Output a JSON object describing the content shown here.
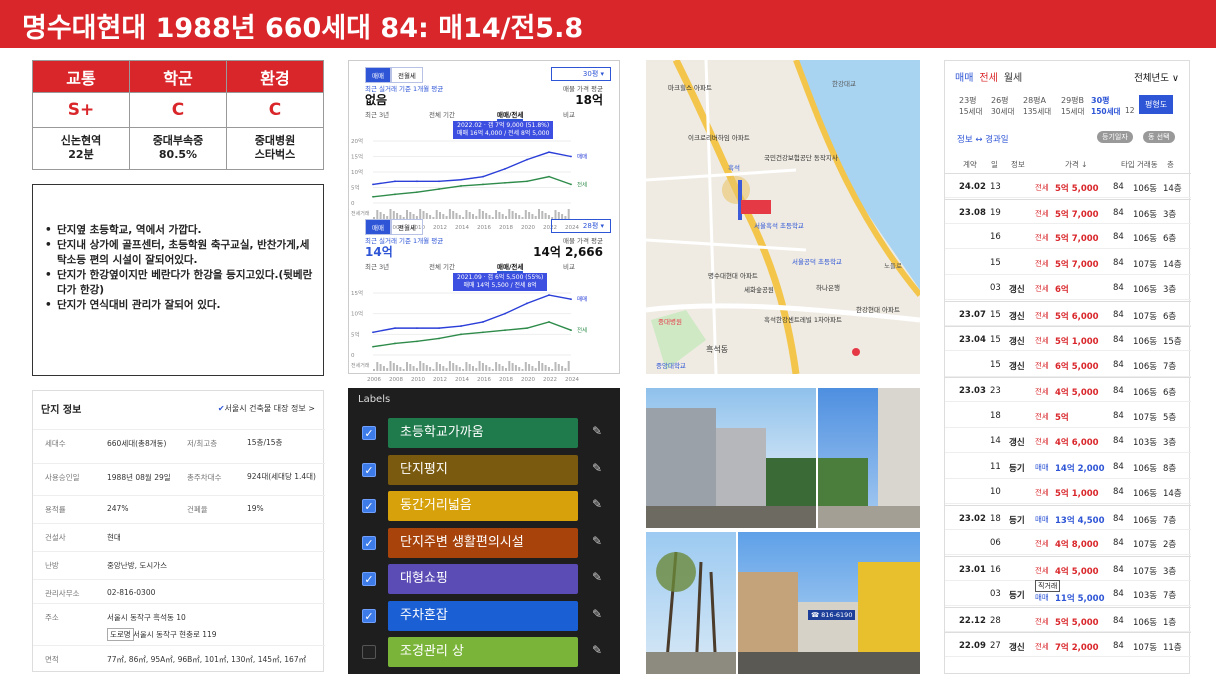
{
  "header": {
    "title": "명수대현대 1988년 660세대 84: 매14/전5.8"
  },
  "rating": {
    "heads": [
      "교통",
      "학군",
      "환경"
    ],
    "grades": [
      "S+",
      "C",
      "C"
    ],
    "descs": [
      [
        "신논현역",
        "22분"
      ],
      [
        "중대부속중",
        "80.5%"
      ],
      [
        "중대병원",
        "스타벅스"
      ]
    ]
  },
  "notes": [
    "단지옆 초등학교, 역에서 가깝다.",
    "단지내 상가에 골프센터, 초등학원 축구교실, 반찬가게,세탁소등 편의 시설이 잘되어있다.",
    "단지가 한강옆이지만 베란다가 한강을 등지고있다.(뒷베란다가 한강)",
    "단지가 연식대비 관리가 잘되어 있다."
  ],
  "info": {
    "title": "단지 정보",
    "link": "서울시 건축물 대장 정보 >",
    "rows": [
      {
        "k": "세대수",
        "v": "660세대(총8개동)",
        "k2": "저/최고층",
        "v2": "15층/15층"
      },
      {
        "k": "사용승인일",
        "v": "1988년 08월 29일",
        "k2": "총주차대수",
        "v2": "924대(세대당 1.4대)"
      },
      {
        "k": "용적률",
        "v": "247%",
        "k2": "건폐율",
        "v2": "19%"
      },
      {
        "k": "건설사",
        "v": "현대",
        "k2": "",
        "v2": ""
      },
      {
        "k": "난방",
        "v": "중앙난방, 도시가스",
        "k2": "",
        "v2": ""
      },
      {
        "k": "관리사무소",
        "v": "02-816-0300",
        "k2": "",
        "v2": ""
      },
      {
        "k": "주소",
        "v": "서울시 동작구 흑석동 10",
        "v3": "서울시 동작구 현충로 119",
        "tag": "도로명",
        "k2": "",
        "v2": ""
      },
      {
        "k": "면적",
        "v": "77㎡, 86㎡, 95A㎡, 96B㎡, 101㎡, 130㎡, 145㎡, 167㎡",
        "k2": "",
        "v2": ""
      }
    ]
  },
  "chart_top": {
    "tabs": [
      "매매",
      "전월세"
    ],
    "select": "30평 ▾",
    "label": "최근 실거래 기준 1개월 평균",
    "value": "없음",
    "label2": "매물 가격 평균",
    "value2": "18억",
    "subtabs": [
      "최근 3년",
      "전체 기간",
      "매매/전세",
      "비교"
    ],
    "tip1": "2022.02 · 갭 7억 9,000 (51.8%)",
    "tip2": "매매 16억 4,000 / 전세 8억 5,000",
    "legend": [
      "매매",
      "전세"
    ],
    "yticks": [
      "20억",
      "15억",
      "10억",
      "5억",
      "0"
    ],
    "xticks": [
      "2006",
      "2008",
      "2010",
      "2012",
      "2014",
      "2016",
      "2018",
      "2020",
      "2022",
      "2024"
    ],
    "volume": "전세거래"
  },
  "chart_bottom": {
    "tabs": [
      "매매",
      "전월세"
    ],
    "select": "28평 ▾",
    "label": "최근 실거래 기준 1개월 평균",
    "value": "14억",
    "label2": "매물 가격 평균",
    "value2": "14억 2,666",
    "subtabs": [
      "최근 3년",
      "전체 기간",
      "매매/전세",
      "비교"
    ],
    "tip1": "2021.09 · 갭 6억 5,500 (55%)",
    "tip2": "매매 14억 5,500 / 전세 8억",
    "legend": [
      "매매",
      "전세"
    ],
    "yticks": [
      "15억",
      "10억",
      "5억",
      "0"
    ],
    "xticks": [
      "2006",
      "2008",
      "2010",
      "2012",
      "2014",
      "2016",
      "2018",
      "2020",
      "2022",
      "2024"
    ],
    "volume": "전세거래"
  },
  "chart_data": [
    {
      "type": "line",
      "title": "30평",
      "x": [
        "2006",
        "2008",
        "2010",
        "2012",
        "2014",
        "2016",
        "2018",
        "2020",
        "2022",
        "2024"
      ],
      "series": [
        {
          "name": "매매",
          "values": [
            6,
            7,
            7,
            7,
            7.5,
            8.5,
            11,
            14,
            16.4,
            15
          ]
        },
        {
          "name": "전세",
          "values": [
            2,
            2.8,
            3.5,
            4.5,
            5.5,
            6,
            6.5,
            7,
            8.5,
            6
          ]
        }
      ],
      "ylim": [
        0,
        20
      ]
    },
    {
      "type": "line",
      "title": "28평",
      "x": [
        "2006",
        "2008",
        "2010",
        "2012",
        "2014",
        "2016",
        "2018",
        "2020",
        "2022",
        "2024"
      ],
      "series": [
        {
          "name": "매매",
          "values": [
            5.5,
            6.5,
            6.5,
            6.5,
            7,
            8,
            10,
            12.5,
            14.5,
            13.5
          ]
        },
        {
          "name": "전세",
          "values": [
            2,
            2.8,
            3.3,
            4,
            5,
            5.5,
            6,
            6.5,
            8,
            6
          ]
        }
      ],
      "ylim": [
        0,
        15
      ]
    }
  ],
  "map": {
    "labels": [
      "마크힐스 아파트",
      "이크로리버하임 아파트",
      "국민건강보험공단 동작지사",
      "흑석",
      "서울흑석 초등학교",
      "명수대현대 아파트",
      "세화숲공원",
      "서울공덕 초등학교",
      "흑석동",
      "중대병원",
      "중앙대학교",
      "한강현대 아파트",
      "노들로",
      "흑석한강센트레빌 1차아파트",
      "하나은행"
    ],
    "roads": [
      "한강대교"
    ]
  },
  "labels": {
    "title": "Labels",
    "items": [
      {
        "text": "초등학교가까움",
        "color": "#1f7a4c",
        "checked": true
      },
      {
        "text": "단지평지",
        "color": "#7a5a0e",
        "checked": true
      },
      {
        "text": "동간거리넓음",
        "color": "#d6a10a",
        "checked": true
      },
      {
        "text": "단지주변 생활편의시설",
        "color": "#a8430c",
        "checked": true
      },
      {
        "text": "대형쇼핑",
        "color": "#5a4bb5",
        "checked": true
      },
      {
        "text": "주차혼잡",
        "color": "#1a5fd4",
        "checked": true
      },
      {
        "text": "조경관리 상",
        "color": "#7ab53a",
        "checked": false
      }
    ]
  },
  "photos": {
    "sign": "☎ 816-6190"
  },
  "tx": {
    "tabs": [
      "매매",
      "전세",
      "월세"
    ],
    "period": "전체년도 ∨",
    "sizes": [
      [
        "23평",
        "15세대"
      ],
      [
        "26평",
        "30세대"
      ],
      [
        "28평A",
        "135세대"
      ],
      [
        "29평B",
        "15세대"
      ],
      [
        "30평",
        "150세대"
      ],
      [
        "",
        "12"
      ]
    ],
    "btn": "평형도",
    "info": "정보 ↔ 경과일",
    "chips": [
      "등기일자",
      "동 선택"
    ],
    "cols": [
      "계약",
      "일",
      "정보",
      "가격 ↓",
      "타입",
      "거래동",
      "층"
    ],
    "rows": [
      {
        "ym": "24.02",
        "d": "13",
        "tag": "",
        "kind": "전세",
        "price": "5억 5,000",
        "t": "84",
        "dong": "106동",
        "fl": "14층"
      },
      {
        "ym": "23.08",
        "d": "19",
        "tag": "",
        "kind": "전세",
        "price": "5억 7,000",
        "t": "84",
        "dong": "106동",
        "fl": "3층"
      },
      {
        "ym": "",
        "d": "16",
        "tag": "",
        "kind": "전세",
        "price": "5억 7,000",
        "t": "84",
        "dong": "106동",
        "fl": "6층"
      },
      {
        "ym": "",
        "d": "15",
        "tag": "",
        "kind": "전세",
        "price": "5억 7,000",
        "t": "84",
        "dong": "107동",
        "fl": "14층"
      },
      {
        "ym": "",
        "d": "03",
        "tag": "갱신",
        "kind": "전세",
        "price": "6억",
        "t": "84",
        "dong": "106동",
        "fl": "3층"
      },
      {
        "ym": "23.07",
        "d": "15",
        "tag": "갱신",
        "kind": "전세",
        "price": "5억 6,000",
        "t": "84",
        "dong": "107동",
        "fl": "6층"
      },
      {
        "ym": "23.04",
        "d": "15",
        "tag": "갱신",
        "kind": "전세",
        "price": "5억 1,000",
        "t": "84",
        "dong": "106동",
        "fl": "15층"
      },
      {
        "ym": "",
        "d": "15",
        "tag": "갱신",
        "kind": "전세",
        "price": "6억 5,000",
        "t": "84",
        "dong": "106동",
        "fl": "7층"
      },
      {
        "ym": "23.03",
        "d": "23",
        "tag": "",
        "kind": "전세",
        "price": "4억 5,000",
        "t": "84",
        "dong": "106동",
        "fl": "6층"
      },
      {
        "ym": "",
        "d": "18",
        "tag": "",
        "kind": "전세",
        "price": "5억",
        "t": "84",
        "dong": "107동",
        "fl": "5층"
      },
      {
        "ym": "",
        "d": "14",
        "tag": "갱신",
        "kind": "전세",
        "price": "4억 6,000",
        "t": "84",
        "dong": "103동",
        "fl": "3층"
      },
      {
        "ym": "",
        "d": "11",
        "tag": "등기",
        "kind": "매매",
        "price": "14억 2,000",
        "t": "84",
        "dong": "106동",
        "fl": "8층"
      },
      {
        "ym": "",
        "d": "10",
        "tag": "",
        "kind": "전세",
        "price": "5억 1,000",
        "t": "84",
        "dong": "106동",
        "fl": "14층"
      },
      {
        "ym": "23.02",
        "d": "18",
        "tag": "등기",
        "kind": "매매",
        "price": "13억 4,500",
        "t": "84",
        "dong": "106동",
        "fl": "7층"
      },
      {
        "ym": "",
        "d": "06",
        "tag": "",
        "kind": "전세",
        "price": "4억 8,000",
        "t": "84",
        "dong": "107동",
        "fl": "2층"
      },
      {
        "ym": "23.01",
        "d": "16",
        "tag": "",
        "kind": "전세",
        "price": "4억 5,000",
        "t": "84",
        "dong": "107동",
        "fl": "3층"
      },
      {
        "ym": "",
        "d": "03",
        "tag": "등기",
        "kind": "매매",
        "price": "11억 5,000",
        "t": "84",
        "dong": "103동",
        "fl": "7층",
        "note": "직거래"
      },
      {
        "ym": "22.12",
        "d": "28",
        "tag": "",
        "kind": "전세",
        "price": "5억 5,000",
        "t": "84",
        "dong": "106동",
        "fl": "1층"
      },
      {
        "ym": "22.09",
        "d": "27",
        "tag": "갱신",
        "kind": "전세",
        "price": "7억 2,000",
        "t": "84",
        "dong": "107동",
        "fl": "11층"
      }
    ]
  }
}
